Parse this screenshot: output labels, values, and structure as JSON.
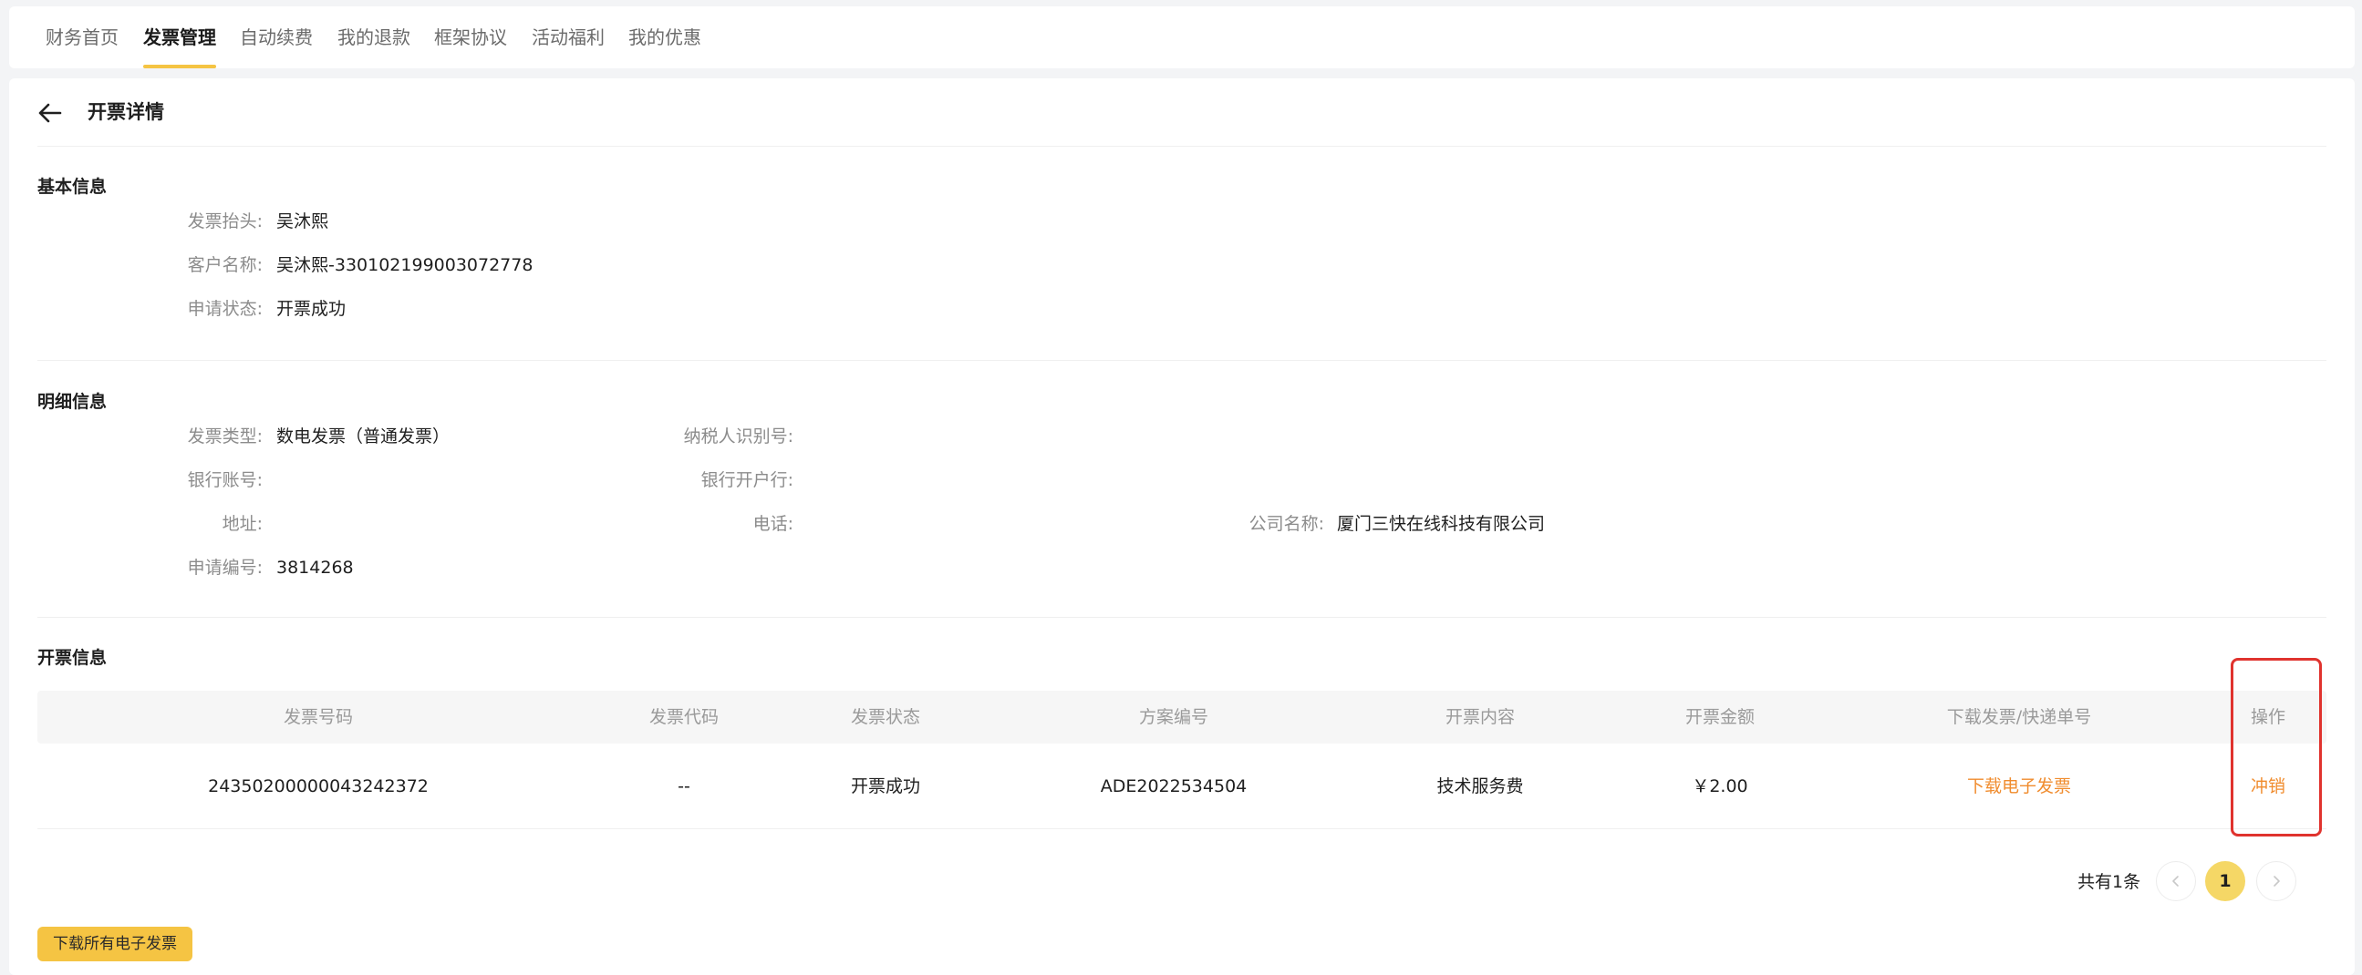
{
  "nav": {
    "tabs": [
      {
        "label": "财务首页",
        "active": false
      },
      {
        "label": "发票管理",
        "active": true
      },
      {
        "label": "自动续费",
        "active": false
      },
      {
        "label": "我的退款",
        "active": false
      },
      {
        "label": "框架协议",
        "active": false
      },
      {
        "label": "活动福利",
        "active": false
      },
      {
        "label": "我的优惠",
        "active": false
      }
    ]
  },
  "header": {
    "title": "开票详情",
    "back_icon": "arrow-left-icon"
  },
  "basic": {
    "title": "基本信息",
    "invoice_title_label": "发票抬头:",
    "invoice_title_value": "吴沐熙",
    "customer_label": "客户名称:",
    "customer_value": "吴沐熙-330102199003072778",
    "status_label": "申请状态:",
    "status_value": "开票成功"
  },
  "detail": {
    "title": "明细信息",
    "type_label": "发票类型:",
    "type_value": "数电发票（普通发票）",
    "taxpayer_label": "纳税人识别号:",
    "taxpayer_value": "",
    "bank_account_label": "银行账号:",
    "bank_account_value": "",
    "bank_name_label": "银行开户行:",
    "bank_name_value": "",
    "address_label": "地址:",
    "address_value": "",
    "phone_label": "电话:",
    "phone_value": "",
    "company_label": "公司名称:",
    "company_value": "厦门三快在线科技有限公司",
    "apply_no_label": "申请编号:",
    "apply_no_value": "3814268"
  },
  "invoice": {
    "title": "开票信息",
    "columns": [
      "发票号码",
      "发票代码",
      "发票状态",
      "方案编号",
      "开票内容",
      "开票金额",
      "下载发票/快递单号",
      "操作"
    ],
    "rows": [
      {
        "number": "24350200000043242372",
        "code": "--",
        "status": "开票成功",
        "plan_no": "ADE2022534504",
        "content": "技术服务费",
        "amount": "￥2.00",
        "download": "下载电子发票",
        "action": "冲销"
      }
    ]
  },
  "pagination": {
    "total_text": "共有1条",
    "current_page": "1",
    "prev_icon": "chevron-left-icon",
    "next_icon": "chevron-right-icon"
  },
  "footer": {
    "download_all_label": "下载所有电子发票"
  },
  "colors": {
    "accent": "#f5c443",
    "link": "#f08c2e",
    "highlight": "#e0332e"
  }
}
